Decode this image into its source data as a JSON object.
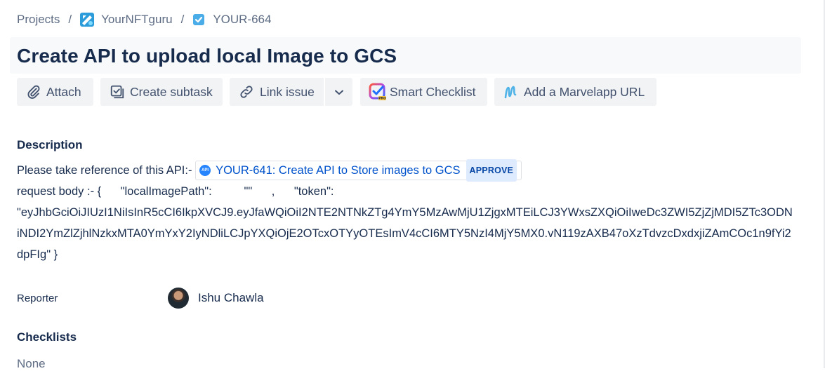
{
  "breadcrumb": {
    "projects": "Projects",
    "project": "YourNFTguru",
    "issue_key": "YOUR-664"
  },
  "issue": {
    "title": "Create API to upload local Image to GCS"
  },
  "toolbar": {
    "attach": "Attach",
    "create_subtask": "Create subtask",
    "link_issue": "Link issue",
    "smart_checklist": "Smart Checklist",
    "marvelapp": "Add a Marvelapp URL"
  },
  "description": {
    "label": "Description",
    "intro": "Please take reference of this API:-",
    "link": {
      "icon_text": "API",
      "text": "YOUR-641: Create API to Store images to GCS",
      "status": "APPROVE"
    },
    "body_line1": "request body :- {      \"localImagePath\":          \"\"      ,      \"token\":",
    "body_line2": "\"eyJhbGciOiJIUzI1NiIsInR5cCI6IkpXVCJ9.eyJfaWQiOiI2NTE2NTNkZTg4YmY5MzAwMjU1ZjgxMTEiLCJ3YWxsZXQiOiIweDc3ZWI5ZjZjMDI5ZTc3ODN",
    "body_line3": "iNDI2YmZlZjhlNzkxMTA0YmYxY2IyNDliLCJpYXQiOjE2OTcxOTYyOTEsImV4cCI6MTY5NzI4MjY5MX0.vN119zAXB47oXzTdvzcDxdxjiZAmCOc1n9fYi2",
    "body_line4": "dpFIg\" }"
  },
  "reporter": {
    "label": "Reporter",
    "name": "Ishu Chawla"
  },
  "checklists": {
    "label": "Checklists",
    "value": "None"
  },
  "colors": {
    "text": "#172b4d",
    "subtle": "#5e6c84",
    "link": "#0052cc",
    "button_bg": "#f2f3f5",
    "lozenge_bg": "#deebff"
  }
}
